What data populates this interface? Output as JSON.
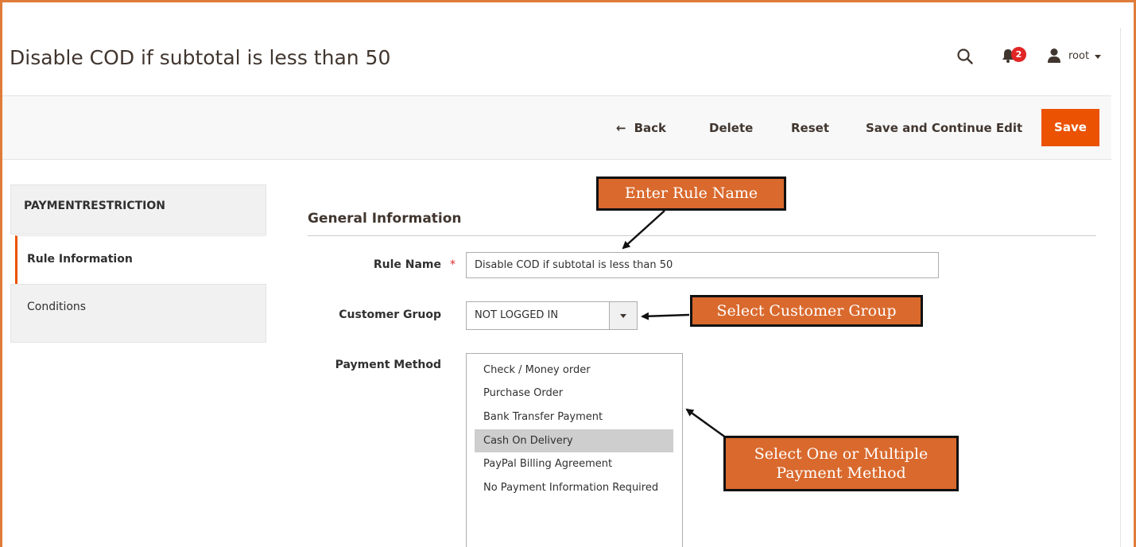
{
  "header": {
    "title": "Disable COD if subtotal is less than 50",
    "notification_count": "2",
    "username": "root",
    "icons": [
      "search-icon",
      "bell-icon",
      "user-icon",
      "caret-down-icon"
    ]
  },
  "actions": {
    "back_label": "Back",
    "delete_label": "Delete",
    "reset_label": "Reset",
    "save_continue_label": "Save and Continue Edit",
    "save_label": "Save"
  },
  "sidebar": {
    "heading": "PAYMENTRESTRICTION",
    "items": [
      {
        "label": "Rule Information",
        "active": true
      },
      {
        "label": "Conditions",
        "active": false
      }
    ]
  },
  "form": {
    "section_title": "General Information",
    "rule_name": {
      "label": "Rule Name",
      "required_mark": "*",
      "value": "Disable COD if subtotal is less than 50"
    },
    "customer_group": {
      "label": "Customer Gruop",
      "value": "NOT LOGGED IN"
    },
    "payment_method": {
      "label": "Payment Method",
      "options": [
        {
          "label": "Check / Money order",
          "selected": false
        },
        {
          "label": "Purchase Order",
          "selected": false
        },
        {
          "label": "Bank Transfer Payment",
          "selected": false
        },
        {
          "label": "Cash On Delivery",
          "selected": true
        },
        {
          "label": "PayPal Billing Agreement",
          "selected": false
        },
        {
          "label": "No Payment Information Required",
          "selected": false
        }
      ]
    }
  },
  "callouts": {
    "rule_name": "Enter Rule Name",
    "customer_group": "Select Customer Group",
    "payment_line1": "Select One or Multiple",
    "payment_line2": "Payment Method"
  },
  "colors": {
    "accent": "#eb5202",
    "frame": "#e07b39",
    "callout_bg": "#d9692d",
    "badge": "#e22626"
  }
}
